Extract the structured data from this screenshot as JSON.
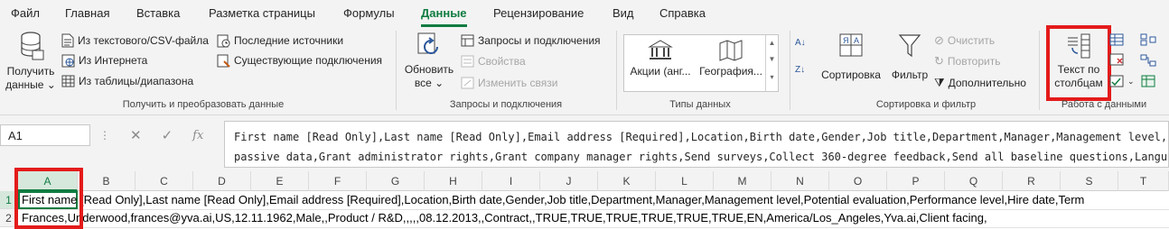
{
  "menu": {
    "tabs": [
      "Файл",
      "Главная",
      "Вставка",
      "Разметка страницы",
      "Формулы",
      "Данные",
      "Рецензирование",
      "Вид",
      "Справка"
    ],
    "active": "Данные"
  },
  "ribbon": {
    "get_data": {
      "button": "Получить данные",
      "button_line1": "Получить",
      "button_line2": "данные",
      "from_text_csv": "Из текстового/CSV-файла",
      "from_web": "Из Интернета",
      "from_table": "Из таблицы/диапазона",
      "recent_sources": "Последние источники",
      "existing_connections": "Существующие подключения",
      "group_label": "Получить и преобразовать данные"
    },
    "queries": {
      "refresh_line1": "Обновить",
      "refresh_line2": "все",
      "queries_connections": "Запросы и подключения",
      "properties": "Свойства",
      "edit_links": "Изменить связи",
      "group_label": "Запросы и подключения"
    },
    "data_types": {
      "stocks": "Акции (анг...",
      "geography": "География...",
      "group_label": "Типы данных"
    },
    "sort_filter": {
      "sort": "Сортировка",
      "filter": "Фильтр",
      "clear": "Очистить",
      "reapply": "Повторить",
      "advanced": "Дополнительно",
      "group_label": "Сортировка и фильтр"
    },
    "data_tools": {
      "text_to_columns_line1": "Текст по",
      "text_to_columns_line2": "столбцам",
      "group_label": "Работа с данными"
    }
  },
  "formula_bar": {
    "name_box": "A1",
    "cancel": "✕",
    "enter": "✓",
    "fx": "fx",
    "line1": "First name [Read Only],Last name [Read Only],Email address [Required],Location,Birth date,Gender,Job title,Department,Manager,Management level,Potential evaluat",
    "line2": "passive data,Grant administrator rights,Grant company manager rights,Send surveys,Collect 360-degree feedback,Send all baseline questions,Language,Time zone,Custo"
  },
  "grid": {
    "columns": [
      "A",
      "B",
      "C",
      "D",
      "E",
      "F",
      "G",
      "H",
      "I",
      "J",
      "K",
      "L",
      "M",
      "N",
      "O",
      "P",
      "Q",
      "R",
      "S",
      "T"
    ],
    "selected_column": "A",
    "rows": [
      "1",
      "2"
    ],
    "row1_text": "First name [Read Only],Last name [Read Only],Email address [Required],Location,Birth date,Gender,Job title,Department,Manager,Management level,Potential evaluation,Performance level,Hire date,Term",
    "row2_text": "Frances,Underwood,frances@yva.ai,US,12.11.1962,Male,,Product / R&D,,,,,08.12.2013,,Contract,,TRUE,TRUE,TRUE,TRUE,TRUE,TRUE,EN,America/Los_Angeles,Yva.ai,Client facing,"
  },
  "colors": {
    "accent": "#107c41",
    "highlight": "#e41b1b",
    "icon_blue": "#2b579a"
  }
}
